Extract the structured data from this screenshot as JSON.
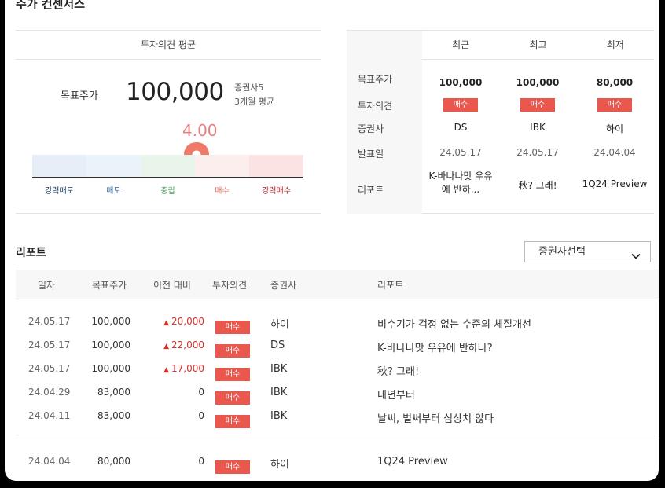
{
  "section_title": "주가 컨센서스",
  "summary": {
    "header": "투자의견 평균",
    "target_label": "목표주가",
    "target_value": "100,000",
    "sub_firms": "증권사5",
    "sub_period": "3개월 평균",
    "score": "4.00",
    "score_value": 4.0,
    "scale_labels": [
      "강력매도",
      "매도",
      "중립",
      "매수",
      "강력매수"
    ],
    "colors": {
      "strong_sell": "#1c3a5e",
      "sell": "#3a6aa0",
      "neutral": "#3e9a55",
      "buy": "#e46a5e",
      "strong_buy": "#b22a2a",
      "pin": "#f07a6a"
    }
  },
  "compare": {
    "row_labels": [
      "목표주가",
      "투자의견",
      "증권사",
      "발표일",
      "리포트"
    ],
    "columns": [
      {
        "header": "최근",
        "price": "100,000",
        "opinion": "매수",
        "firm": "DS",
        "date": "24.05.17",
        "report": "K-바나나맛 우유에 반하..."
      },
      {
        "header": "최고",
        "price": "100,000",
        "opinion": "매수",
        "firm": "IBK",
        "date": "24.05.17",
        "report": "秋? 그래!"
      },
      {
        "header": "최저",
        "price": "80,000",
        "opinion": "매수",
        "firm": "하이",
        "date": "24.04.04",
        "report": "1Q24 Preview"
      }
    ]
  },
  "reports": {
    "title": "리포트",
    "select_label": "증권사선택",
    "headers": [
      "일자",
      "목표주가",
      "이전 대비",
      "투자의견",
      "증권사",
      "리포트"
    ],
    "rows": [
      {
        "date": "24.05.17",
        "price": "100,000",
        "diff": "20,000",
        "up": true,
        "opinion": "매수",
        "firm": "하이",
        "report": "비수기가 걱정 없는 수준의 체질개선"
      },
      {
        "date": "24.05.17",
        "price": "100,000",
        "diff": "22,000",
        "up": true,
        "opinion": "매수",
        "firm": "DS",
        "report": "K-바나나맛 우유에 반하나?"
      },
      {
        "date": "24.05.17",
        "price": "100,000",
        "diff": "17,000",
        "up": true,
        "opinion": "매수",
        "firm": "IBK",
        "report": "秋? 그래!"
      },
      {
        "date": "24.04.29",
        "price": "83,000",
        "diff": "0",
        "up": false,
        "opinion": "매수",
        "firm": "IBK",
        "report": "내년부터"
      },
      {
        "date": "24.04.11",
        "price": "83,000",
        "diff": "0",
        "up": false,
        "opinion": "매수",
        "firm": "IBK",
        "report": "날씨, 벌써부터 심상치 않다"
      },
      {
        "date": "24.04.04",
        "price": "80,000",
        "diff": "0",
        "up": false,
        "opinion": "매수",
        "firm": "하이",
        "report": "1Q24 Preview"
      }
    ]
  }
}
